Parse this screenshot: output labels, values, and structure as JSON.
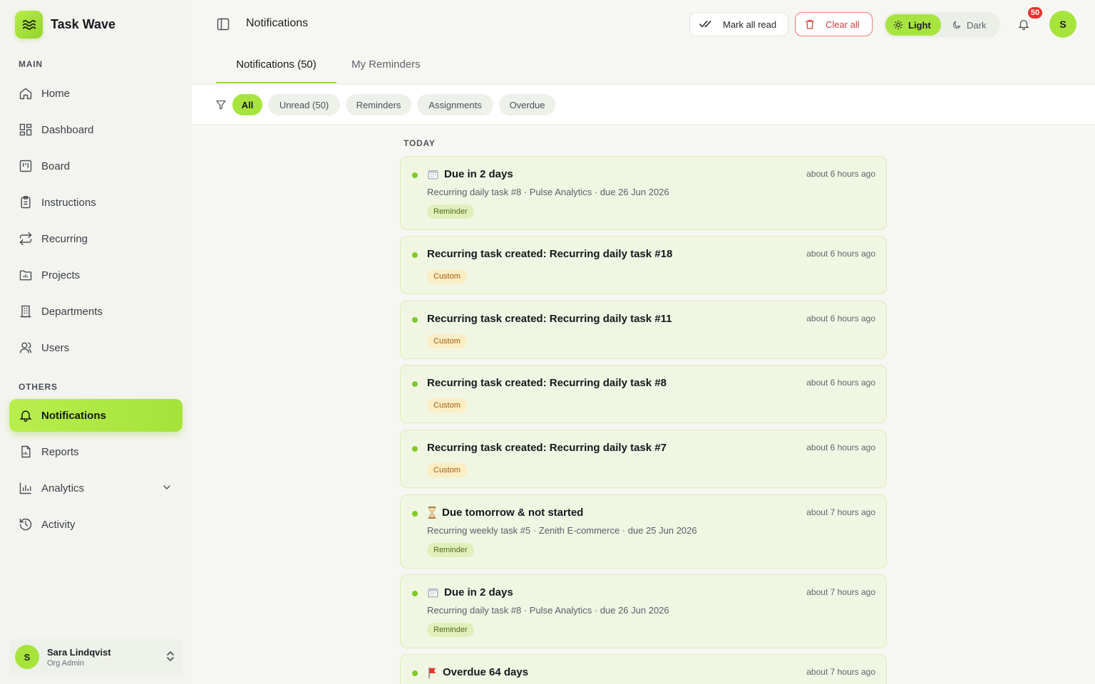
{
  "app": {
    "name": "Task Wave"
  },
  "sidebar": {
    "main_label": "MAIN",
    "others_label": "OTHERS",
    "main_items": [
      {
        "label": "Home",
        "icon": "home-icon"
      },
      {
        "label": "Dashboard",
        "icon": "dashboard-icon"
      },
      {
        "label": "Board",
        "icon": "board-icon"
      },
      {
        "label": "Instructions",
        "icon": "clipboard-icon"
      },
      {
        "label": "Recurring",
        "icon": "repeat-icon"
      },
      {
        "label": "Projects",
        "icon": "folder-icon"
      },
      {
        "label": "Departments",
        "icon": "building-icon"
      },
      {
        "label": "Users",
        "icon": "users-icon"
      }
    ],
    "other_items": [
      {
        "label": "Notifications",
        "icon": "bell-icon",
        "active": true
      },
      {
        "label": "Reports",
        "icon": "report-icon"
      },
      {
        "label": "Analytics",
        "icon": "analytics-icon"
      },
      {
        "label": "Activity",
        "icon": "history-icon"
      }
    ],
    "user": {
      "initial": "S",
      "name": "Sara Lindqvist",
      "role": "Org Admin"
    }
  },
  "header": {
    "title": "Notifications",
    "mark_all_read": "Mark all read",
    "clear_all": "Clear all",
    "theme_light": "Light",
    "theme_dark": "Dark",
    "badge_count": "50",
    "avatar_initial": "S"
  },
  "tabs": [
    {
      "label": "Notifications (50)",
      "active": true
    },
    {
      "label": "My Reminders",
      "active": false
    }
  ],
  "filters": [
    {
      "label": "All",
      "active": true
    },
    {
      "label": "Unread (50)",
      "active": false
    },
    {
      "label": "Reminders",
      "active": false
    },
    {
      "label": "Assignments",
      "active": false
    },
    {
      "label": "Overdue",
      "active": false
    }
  ],
  "group_label": "TODAY",
  "notifications": [
    {
      "emoji": "calendar",
      "title": "Due in 2 days",
      "time": "about 6 hours ago",
      "subtitle": "Recurring daily task #8 · Pulse Analytics · due 26 Jun 2026",
      "tag": "Reminder",
      "tag_type": "reminder"
    },
    {
      "emoji": "",
      "title": "Recurring task created: Recurring daily task #18",
      "time": "about 6 hours ago",
      "subtitle": "",
      "tag": "Custom",
      "tag_type": "custom"
    },
    {
      "emoji": "",
      "title": "Recurring task created: Recurring daily task #11",
      "time": "about 6 hours ago",
      "subtitle": "",
      "tag": "Custom",
      "tag_type": "custom"
    },
    {
      "emoji": "",
      "title": "Recurring task created: Recurring daily task #8",
      "time": "about 6 hours ago",
      "subtitle": "",
      "tag": "Custom",
      "tag_type": "custom"
    },
    {
      "emoji": "",
      "title": "Recurring task created: Recurring daily task #7",
      "time": "about 6 hours ago",
      "subtitle": "",
      "tag": "Custom",
      "tag_type": "custom"
    },
    {
      "emoji": "hourglass",
      "title": "Due tomorrow & not started",
      "time": "about 7 hours ago",
      "subtitle": "Recurring weekly task #5 · Zenith E-commerce · due 25 Jun 2026",
      "tag": "Reminder",
      "tag_type": "reminder"
    },
    {
      "emoji": "calendar",
      "title": "Due in 2 days",
      "time": "about 7 hours ago",
      "subtitle": "Recurring daily task #8 · Pulse Analytics · due 26 Jun 2026",
      "tag": "Reminder",
      "tag_type": "reminder"
    },
    {
      "emoji": "flag",
      "title": "Overdue 64 days",
      "time": "about 7 hours ago",
      "subtitle": "",
      "tag": "",
      "tag_type": ""
    }
  ],
  "colors": {
    "accent": "#a8e43e",
    "danger": "#e5342e",
    "unread_dot": "#7ecb27"
  }
}
